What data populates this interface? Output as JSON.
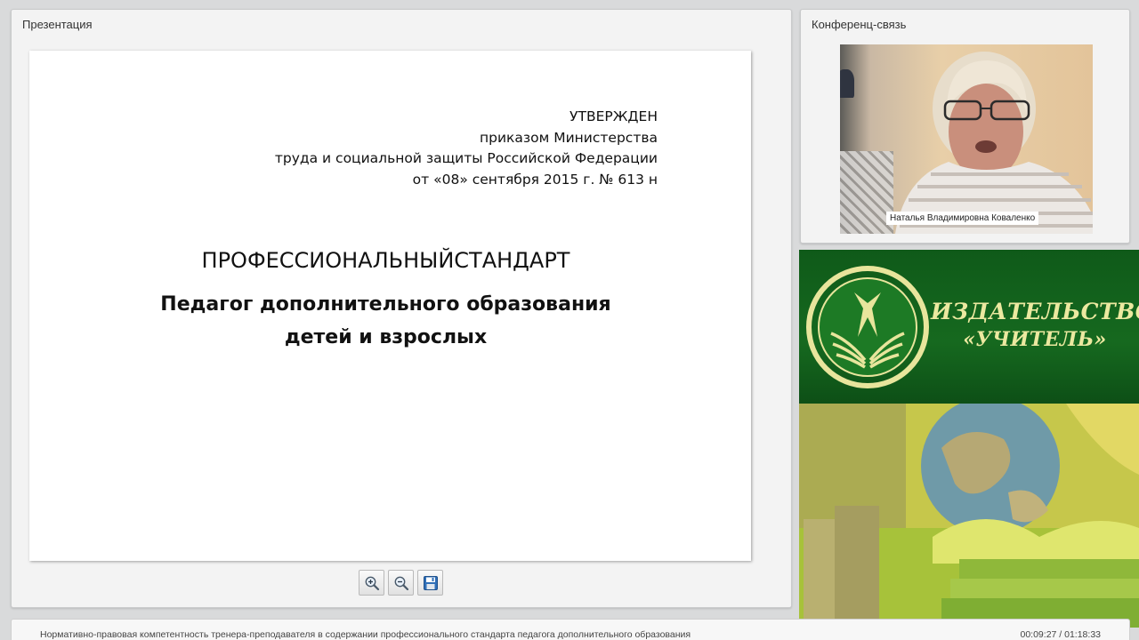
{
  "presentation": {
    "panel_title": "Презентация",
    "slide": {
      "approved_lines": [
        "УТВЕРЖДЕН",
        "приказом Министерства",
        "труда и социальной защиты Российской Федерации",
        "от «08»  сентября 2015 г. № 613 н"
      ],
      "title": "ПРОФЕССИОНАЛЬНЫЙСТАНДАРТ",
      "subtitle_lines": [
        "Педагог дополнительного образования",
        "детей и взрослых"
      ]
    },
    "toolbar": {
      "zoom_in_icon": "zoom-in-icon",
      "zoom_out_icon": "zoom-out-icon",
      "save_icon": "floppy-disk-icon"
    }
  },
  "conference": {
    "panel_title": "Конференц-связь",
    "speaker_name": "Наталья Владимировна Коваленко"
  },
  "banner": {
    "line1": "ИЗДАТЕЛЬСТВО",
    "line2": "«УЧИТЕЛЬ»",
    "colors": {
      "background": "#16691f",
      "text": "#ece9a0"
    }
  },
  "status": {
    "title": "Нормативно-правовая компетентность тренера-преподавателя в содержании профессионального стандарта педагога дополнительного образования",
    "time": "00:09:27 / 01:18:33"
  }
}
